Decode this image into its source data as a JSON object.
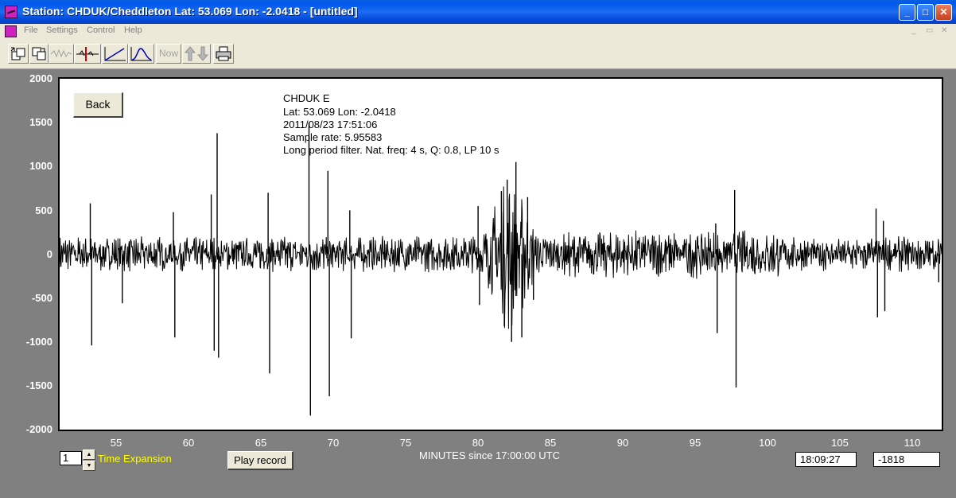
{
  "window": {
    "title": "Station: CHDUK/Cheddleton Lat: 53.069 Lon: -2.0418 - [untitled]",
    "minimize": "_",
    "maximize": "□",
    "close": "✕"
  },
  "menu": {
    "items": [
      "File",
      "Settings",
      "Control",
      "Help"
    ],
    "mdi_controls": [
      "_",
      "▭",
      "✕"
    ]
  },
  "toolbar": {
    "buttons": [
      {
        "name": "open-file-icon",
        "enabled": true
      },
      {
        "name": "save-file-icon",
        "enabled": true
      },
      {
        "name": "waveform-icon",
        "enabled": false
      },
      {
        "name": "marker-cursor-icon",
        "enabled": true
      },
      {
        "name": "linear-ramp-icon",
        "enabled": true
      },
      {
        "name": "bell-curve-icon",
        "enabled": true
      },
      {
        "name": "now-label",
        "enabled": false
      },
      {
        "name": "up-down-arrows-icon",
        "enabled": false
      },
      {
        "name": "printer-icon",
        "enabled": true
      }
    ],
    "now_label": "Now"
  },
  "plot": {
    "back_label": "Back",
    "info": [
      "CHDUK  E",
      "Lat: 53.069 Lon: -2.0418",
      "2011/08/23 17:51:06",
      "Sample rate: 5.95583",
      "Long period filter. Nat. freq: 4 s, Q: 0.8, LP 10 s"
    ]
  },
  "chart_data": {
    "type": "line",
    "title": "",
    "xlabel": "MINUTES since 17:00:00 UTC",
    "ylabel": "",
    "xlim": [
      51.5,
      112
    ],
    "ylim": [
      -2000,
      2000
    ],
    "x_ticks": [
      55,
      60,
      65,
      70,
      75,
      80,
      85,
      90,
      95,
      100,
      105,
      110
    ],
    "y_ticks": [
      2000,
      1500,
      1000,
      500,
      0,
      -500,
      -1000,
      -1500,
      -2000
    ],
    "grid": false,
    "line_color": "#000000",
    "background_noise_amplitude": 150,
    "events": [
      {
        "x": 53.6,
        "y": 580
      },
      {
        "x": 53.7,
        "y": -1040
      },
      {
        "x": 55.8,
        "y": -560
      },
      {
        "x": 59.3,
        "y": 480
      },
      {
        "x": 59.4,
        "y": -950
      },
      {
        "x": 61.9,
        "y": 680
      },
      {
        "x": 62.1,
        "y": -1100
      },
      {
        "x": 62.3,
        "y": 1380
      },
      {
        "x": 62.4,
        "y": -1180
      },
      {
        "x": 65.8,
        "y": 700
      },
      {
        "x": 65.9,
        "y": -1360
      },
      {
        "x": 68.6,
        "y": 1500
      },
      {
        "x": 68.7,
        "y": -1840
      },
      {
        "x": 69.9,
        "y": 950
      },
      {
        "x": 70.0,
        "y": -1620
      },
      {
        "x": 71.4,
        "y": 500
      },
      {
        "x": 71.5,
        "y": -960
      },
      {
        "x": 80.2,
        "y": 550
      },
      {
        "x": 80.3,
        "y": -580
      },
      {
        "x": 81.8,
        "y": 720
      },
      {
        "x": 82.0,
        "y": -820
      },
      {
        "x": 82.2,
        "y": 850
      },
      {
        "x": 82.5,
        "y": -1000
      },
      {
        "x": 82.8,
        "y": 1050
      },
      {
        "x": 83.2,
        "y": -950
      },
      {
        "x": 83.6,
        "y": 650
      },
      {
        "x": 84.0,
        "y": -520
      },
      {
        "x": 96.5,
        "y": 350
      },
      {
        "x": 96.6,
        "y": -900
      },
      {
        "x": 97.8,
        "y": 730
      },
      {
        "x": 97.9,
        "y": -1520
      },
      {
        "x": 107.5,
        "y": 520
      },
      {
        "x": 107.6,
        "y": -720
      },
      {
        "x": 108.0,
        "y": 380
      },
      {
        "x": 108.1,
        "y": -650
      },
      {
        "x": 111.8,
        "y": -320
      }
    ],
    "annotations": [
      "CHDUK  E",
      "Lat: 53.069 Lon: -2.0418",
      "2011/08/23 17:51:06",
      "Sample rate: 5.95583",
      "Long period filter. Nat. freq: 4 s, Q: 0.8, LP 10 s"
    ]
  },
  "controls": {
    "time_expansion_value": "1",
    "time_expansion_label": "Time Expansion",
    "play_label": "Play record",
    "time_readout": "18:09:27",
    "value_readout": "-1818",
    "spin_up": "▲",
    "spin_down": "▼"
  },
  "colors": {
    "background": "#808080",
    "plot_bg": "#ffffff",
    "axis_label": "#ffffff",
    "time_expansion_label": "#ffff00",
    "titlebar": "#0058ee"
  }
}
